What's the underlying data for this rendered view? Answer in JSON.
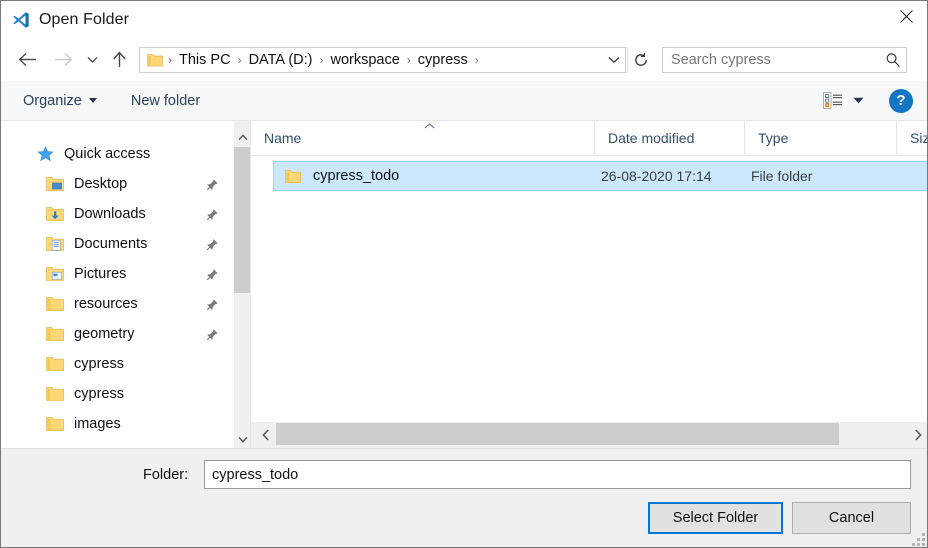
{
  "window": {
    "title": "Open Folder",
    "app_icon": "vscode-icon",
    "close_label": "✕"
  },
  "nav": {
    "back_icon": "back-arrow-icon",
    "forward_icon": "forward-arrow-icon",
    "recent_icon": "chevron-down-icon",
    "up_icon": "up-arrow-icon",
    "refresh_icon": "refresh-icon",
    "address_dropdown_icon": "chevron-down-icon"
  },
  "breadcrumb": {
    "folder_icon": "folder-icon",
    "separator": "›",
    "items": [
      {
        "label": "This PC"
      },
      {
        "label": "DATA (D:)"
      },
      {
        "label": "workspace"
      },
      {
        "label": "cypress"
      }
    ]
  },
  "search": {
    "placeholder": "Search cypress",
    "value": "",
    "icon": "search-icon"
  },
  "toolbar": {
    "organize_label": "Organize",
    "new_folder_label": "New folder",
    "view_icon": "list-view-icon",
    "view_caret_icon": "chevron-down-icon",
    "help_label": "?",
    "help_icon": "help-icon",
    "help_color": "#1275c4"
  },
  "sidebar": {
    "items": [
      {
        "label": "Quick access",
        "icon": "star-icon",
        "level": 0,
        "pinned": false
      },
      {
        "label": "Desktop",
        "icon": "desktop-folder-icon",
        "level": 1,
        "pinned": true
      },
      {
        "label": "Downloads",
        "icon": "downloads-folder-icon",
        "level": 1,
        "pinned": true
      },
      {
        "label": "Documents",
        "icon": "documents-folder-icon",
        "level": 1,
        "pinned": true
      },
      {
        "label": "Pictures",
        "icon": "pictures-folder-icon",
        "level": 1,
        "pinned": true
      },
      {
        "label": "resources",
        "icon": "folder-icon",
        "level": 1,
        "pinned": true
      },
      {
        "label": "geometry",
        "icon": "folder-icon",
        "level": 1,
        "pinned": true
      },
      {
        "label": "cypress",
        "icon": "folder-icon",
        "level": 1,
        "pinned": false
      },
      {
        "label": "cypress",
        "icon": "folder-icon",
        "level": 1,
        "pinned": false
      },
      {
        "label": "images",
        "icon": "folder-icon",
        "level": 1,
        "pinned": false
      }
    ],
    "scrollbar": {
      "up_icon": "chevron-up-icon",
      "down_icon": "chevron-down-icon"
    }
  },
  "filelist": {
    "columns": [
      {
        "label": "Name",
        "sorted": "asc"
      },
      {
        "label": "Date modified",
        "sorted": ""
      },
      {
        "label": "Type",
        "sorted": ""
      },
      {
        "label": "Size",
        "sorted": ""
      }
    ],
    "rows": [
      {
        "name": "cypress_todo",
        "date_modified": "26-08-2020 17:14",
        "type": "File folder",
        "size": "",
        "icon": "folder-icon",
        "selected": true
      }
    ],
    "selection_color": "#cce8ff",
    "scrollbar": {
      "left_icon": "chevron-left-icon",
      "right_icon": "chevron-right-icon"
    }
  },
  "footer": {
    "folder_label": "Folder:",
    "folder_value": "cypress_todo",
    "select_button": "Select Folder",
    "cancel_button": "Cancel",
    "focus_color": "#0078d7",
    "resize_grip_icon": "resize-grip-icon"
  }
}
